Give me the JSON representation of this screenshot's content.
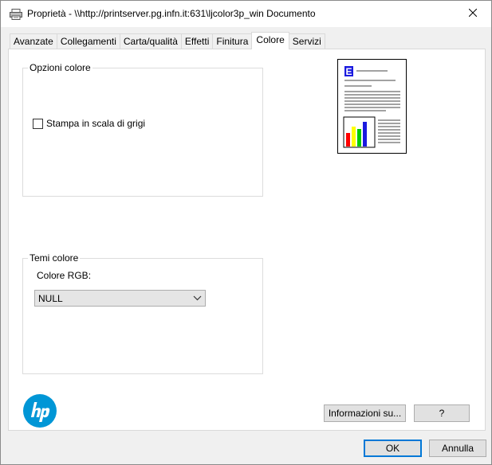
{
  "window": {
    "title": "Proprietà - \\\\http://printserver.pg.infn.it:631\\ljcolor3p_win Documento",
    "close_glyph": "✕"
  },
  "tabs": [
    {
      "label": "Avanzate",
      "active": false
    },
    {
      "label": "Collegamenti",
      "active": false
    },
    {
      "label": "Carta/qualità",
      "active": false
    },
    {
      "label": "Effetti",
      "active": false
    },
    {
      "label": "Finitura",
      "active": false
    },
    {
      "label": "Colore",
      "active": true
    },
    {
      "label": "Servizi",
      "active": false
    }
  ],
  "color_options": {
    "group_title": "Opzioni colore",
    "grayscale_label": "Stampa in scala di grigi",
    "grayscale_checked": false
  },
  "color_themes": {
    "group_title": "Temi colore",
    "rgb_label": "Colore RGB:",
    "rgb_value": "NULL"
  },
  "preview": {
    "letter": "E",
    "letter_color": "#1a1adf",
    "bar_colors": [
      "#ff0000",
      "#ffff00",
      "#00cc00",
      "#1a1adf"
    ]
  },
  "buttons": {
    "info_label": "Informazioni su...",
    "help_label": "?",
    "ok_label": "OK",
    "cancel_label": "Annulla"
  },
  "colors": {
    "hp_blue": "#0096d6",
    "default_button_border": "#0078d7"
  }
}
